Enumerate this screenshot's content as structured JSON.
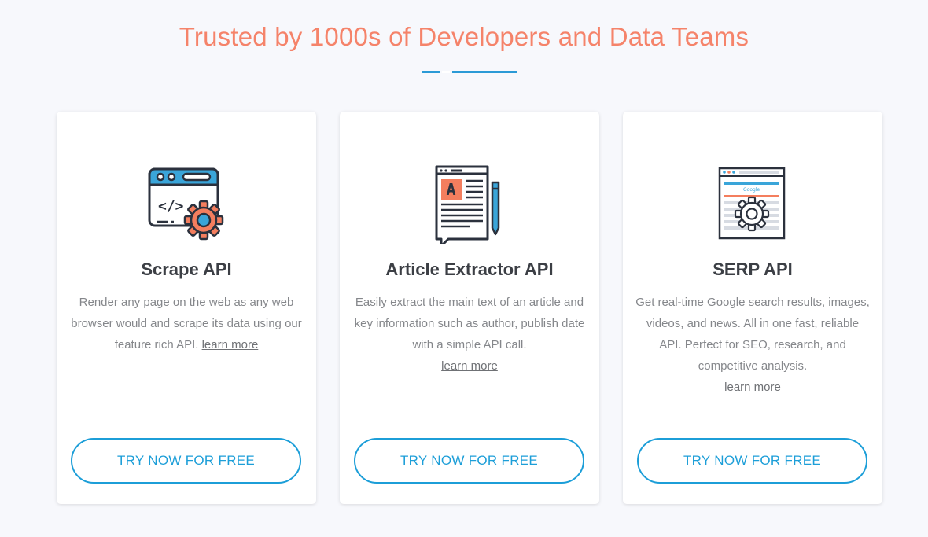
{
  "heading": "Trusted by 1000s of Developers and Data Teams",
  "colors": {
    "heading": "#f5836a",
    "accent": "#1c9ed8",
    "icon_blue": "#3aa5d9",
    "icon_orange": "#f47e5e",
    "icon_dark": "#2b313d",
    "background": "#f7f8fc"
  },
  "cards": [
    {
      "icon": "code-window-gear-icon",
      "title": "Scrape API",
      "description": "Render any page on the web as any web browser would and scrape its data using our feature rich API.",
      "link": "learn more",
      "button": "TRY NOW FOR FREE"
    },
    {
      "icon": "article-newspaper-pen-icon",
      "title": "Article Extractor API",
      "description": "Easily extract the main text of an article and key information such as author, publish date with a simple API call.",
      "link": "learn more",
      "button": "TRY NOW FOR FREE"
    },
    {
      "icon": "google-serp-gear-icon",
      "title": "SERP API",
      "description": "Get real-time Google search results, images, videos, and news. All in one fast, reliable API. Perfect for SEO, research, and competitive analysis.",
      "link": "learn more",
      "button": "TRY NOW FOR FREE",
      "icon_label": "Google"
    }
  ]
}
